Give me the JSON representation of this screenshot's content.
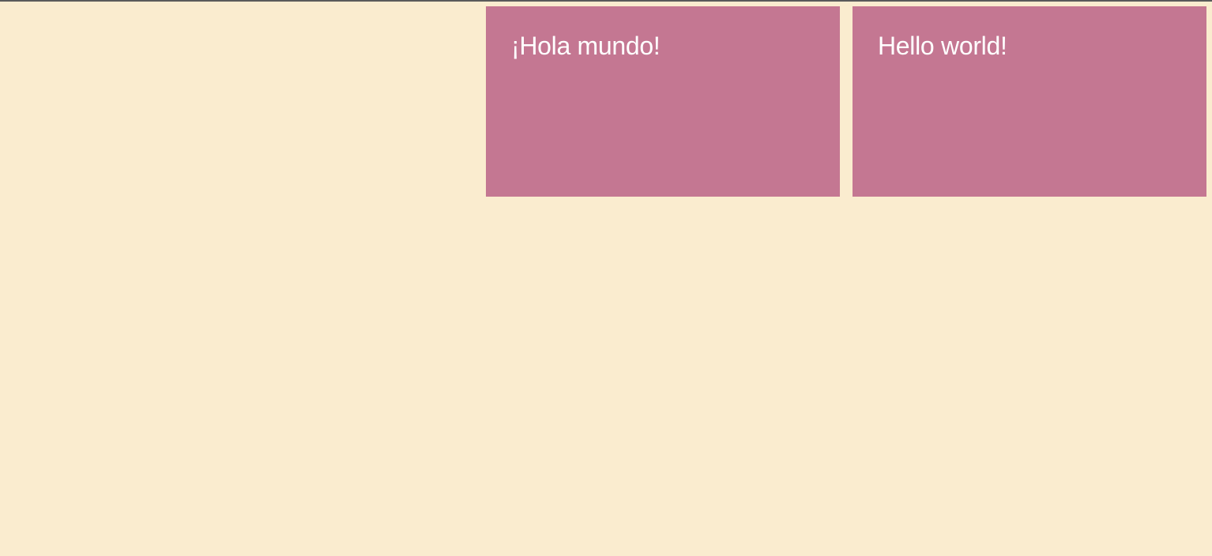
{
  "colors": {
    "page_background": "#faeccf",
    "card_background": "#c47792",
    "card_text": "#ffffff",
    "top_border": "#5a5a5a"
  },
  "cards": [
    {
      "text": "¡Hola mundo!"
    },
    {
      "text": "Hello world!"
    }
  ]
}
